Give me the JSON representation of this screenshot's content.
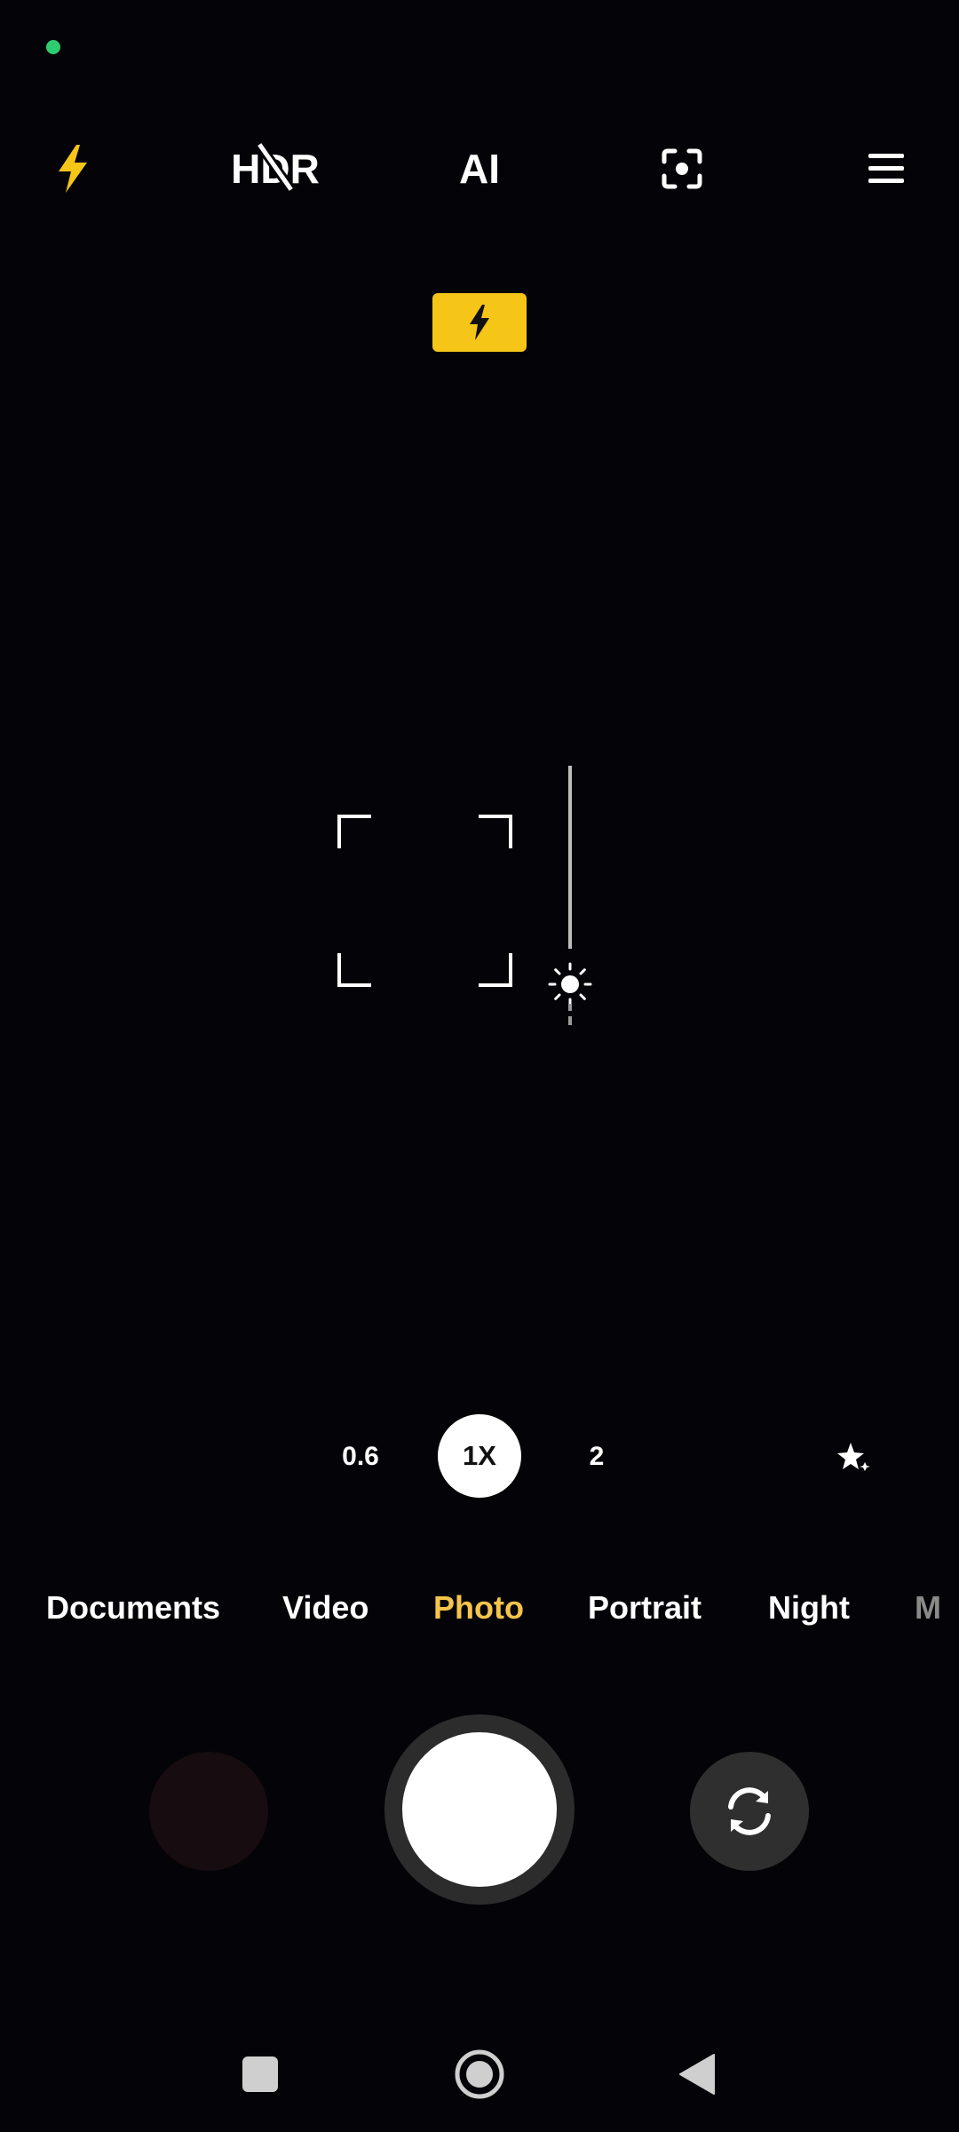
{
  "app": {
    "name": "Camera"
  },
  "status": {
    "indicator_color": "#2ecc71"
  },
  "top_toolbar": {
    "flash": {
      "icon": "flash-icon",
      "color": "#f5c518"
    },
    "hdr": {
      "label": "HDR",
      "icon": "hdr-off-icon"
    },
    "ai": {
      "label": "AI"
    },
    "lens": {
      "icon": "google-lens-icon"
    },
    "menu": {
      "icon": "menu-icon"
    }
  },
  "flash_indicator": {
    "icon": "flash-on-icon",
    "color": "#f5c518"
  },
  "exposure": {
    "icon": "sun-icon"
  },
  "zoom": {
    "options": [
      "0.6",
      "1X",
      "2"
    ],
    "selected": "1X",
    "effects_icon": "beauty-sparkle-icon"
  },
  "modes": {
    "items": [
      "Documents",
      "Video",
      "Photo",
      "Portrait",
      "Night",
      "M"
    ],
    "selected": "Photo",
    "active_color": "#f5c44a"
  },
  "bottom_controls": {
    "gallery": {
      "icon": "gallery-thumbnail"
    },
    "shutter": {
      "icon": "shutter-button"
    },
    "switch_camera": {
      "icon": "switch-camera-icon"
    }
  },
  "nav_bar": {
    "recents": {
      "icon": "recents-square-icon"
    },
    "home": {
      "icon": "home-circle-icon"
    },
    "back": {
      "icon": "back-triangle-icon"
    }
  }
}
